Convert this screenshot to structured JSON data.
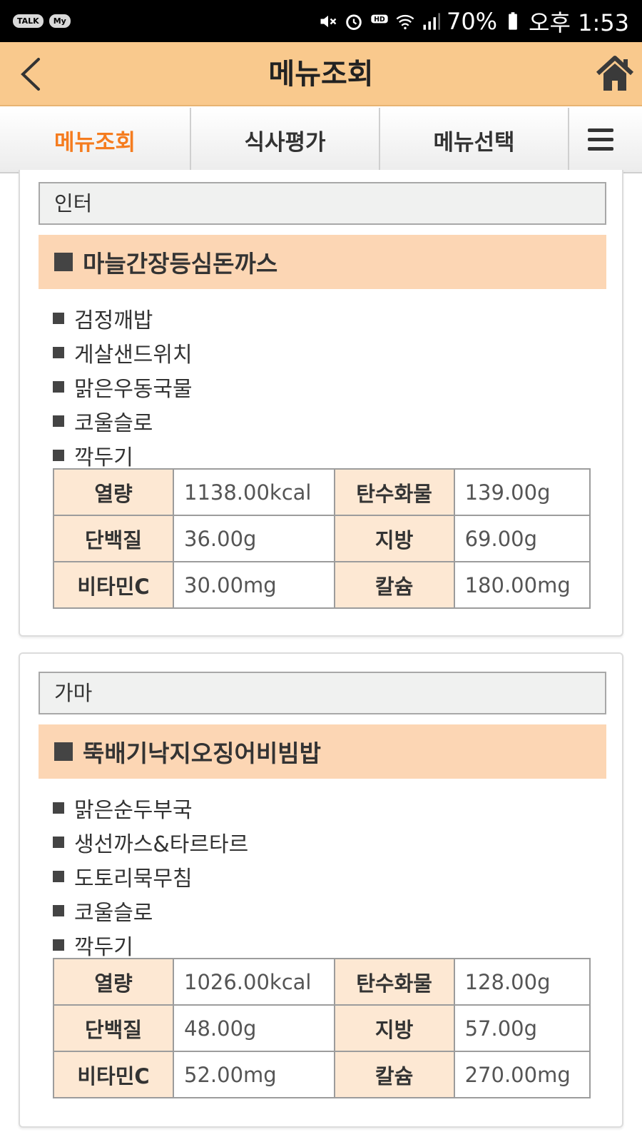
{
  "status_bar": {
    "left_badges": [
      "TALK",
      "My"
    ],
    "battery": "70%",
    "time": "오후 1:53",
    "icons": [
      "mute-icon",
      "alarm-icon",
      "hd-voice-icon",
      "wifi-icon",
      "signal-icon",
      "battery-icon"
    ]
  },
  "header": {
    "title": "메뉴조회",
    "back_icon": "chevron-left-icon",
    "home_icon": "home-icon"
  },
  "tabs": [
    {
      "label": "메뉴조회",
      "active": true
    },
    {
      "label": "식사평가",
      "active": false
    },
    {
      "label": "메뉴선택",
      "active": false
    }
  ],
  "menus": [
    {
      "location": "인터",
      "main_dish": "마늘간장등심돈까스",
      "sides": [
        "검정깨밥",
        "게살샌드위치",
        "맑은우동국물",
        "코울슬로",
        "깍두기"
      ],
      "nutrition": [
        {
          "k1": "열량",
          "v1": "1138.00kcal",
          "k2": "탄수화물",
          "v2": "139.00g"
        },
        {
          "k1": "단백질",
          "v1": "36.00g",
          "k2": "지방",
          "v2": "69.00g"
        },
        {
          "k1": "비타민C",
          "v1": "30.00mg",
          "k2": "칼슘",
          "v2": "180.00mg"
        }
      ]
    },
    {
      "location": "가마",
      "main_dish": "뚝배기낙지오징어비빔밥",
      "sides": [
        "맑은순두부국",
        "생선까스&타르타르",
        "도토리묵무침",
        "코울슬로",
        "깍두기"
      ],
      "nutrition": [
        {
          "k1": "열량",
          "v1": "1026.00kcal",
          "k2": "탄수화물",
          "v2": "128.00g"
        },
        {
          "k1": "단백질",
          "v1": "48.00g",
          "k2": "지방",
          "v2": "57.00g"
        },
        {
          "k1": "비타민C",
          "v1": "52.00mg",
          "k2": "칼슘",
          "v2": "270.00mg"
        }
      ]
    }
  ],
  "colors": {
    "header_bg": "#f9c98d",
    "active_tab": "#f57c1f",
    "dish_bg": "#fcd6b4",
    "table_header_bg": "#fde8d3"
  }
}
